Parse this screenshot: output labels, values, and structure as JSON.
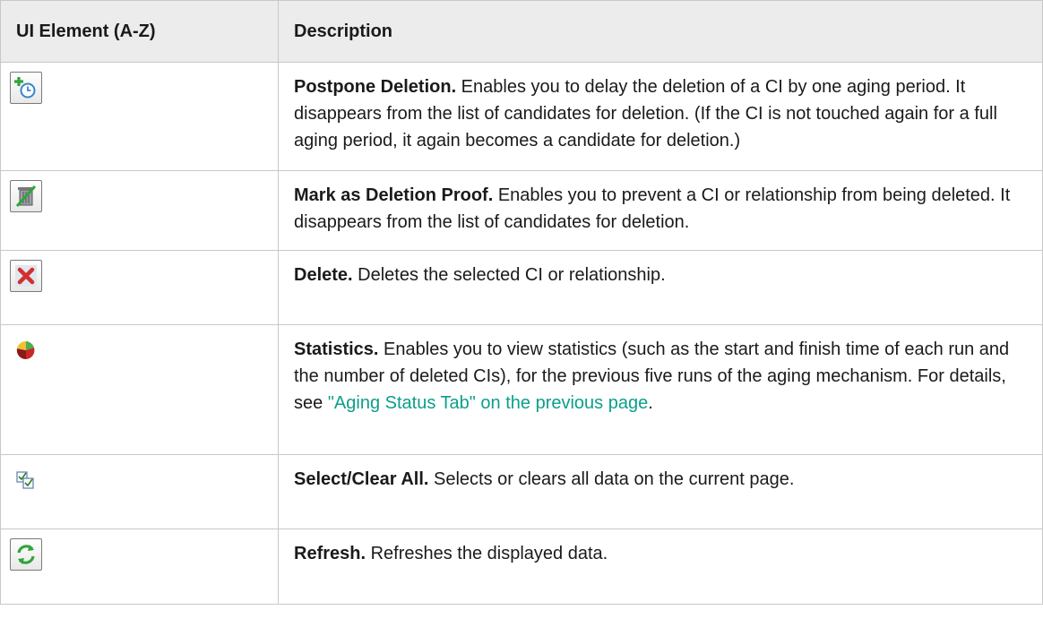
{
  "table": {
    "headers": [
      "UI Element (A-Z)",
      "Description"
    ],
    "rows": [
      {
        "icon": "postpone-deletion-clock-plus-icon",
        "term": "Postpone Deletion.",
        "text": " Enables you to delay the deletion of a CI by one aging period. It disappears from the list of candidates for deletion. (If the CI is not touched again for a full aging period, it again becomes a candidate for deletion.)"
      },
      {
        "icon": "deletion-proof-trash-icon",
        "term": "Mark as Deletion Proof.",
        "text": " Enables you to prevent a CI or relationship from being deleted. It disappears from the list of candidates for deletion."
      },
      {
        "icon": "delete-x-icon",
        "term": "Delete.",
        "text": " Deletes the selected CI or relationship."
      },
      {
        "icon": "statistics-pie-icon",
        "term": "Statistics.",
        "text": " Enables you to view statistics (such as the start and finish time of each run and the number of deleted CIs), for the previous five runs of the aging mechanism. For details, see ",
        "link": "\"Aging Status Tab\" on the previous page",
        "after": "."
      },
      {
        "icon": "select-clear-all-checkbox-icon",
        "term": "Select/Clear All.",
        "text": " Selects or clears all data on the current page."
      },
      {
        "icon": "refresh-arrows-icon",
        "term": "Refresh.",
        "text": " Refreshes the displayed data."
      }
    ]
  },
  "colors": {
    "header_bg": "#ececec",
    "border": "#c8c8c8",
    "link": "#0b9f8a"
  }
}
